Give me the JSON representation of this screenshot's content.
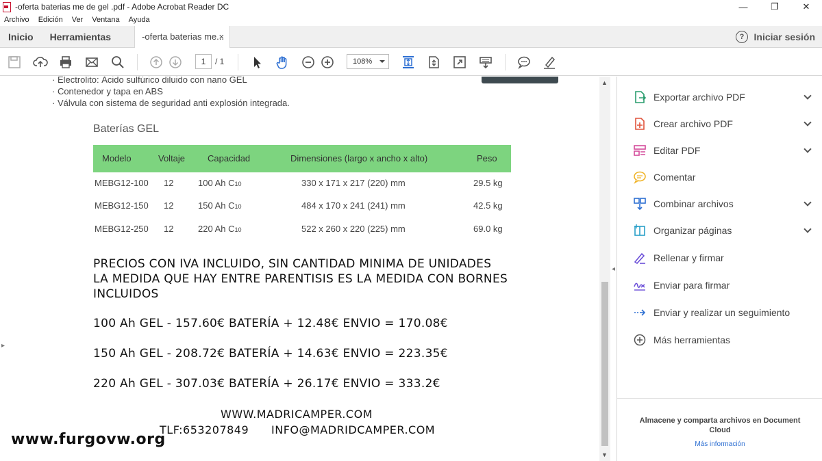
{
  "window": {
    "title": "-oferta baterias me de gel .pdf - Adobe Acrobat Reader DC",
    "minimize": "—",
    "maximize": "❐",
    "close": "✕"
  },
  "menu": [
    "Archivo",
    "Edición",
    "Ver",
    "Ventana",
    "Ayuda"
  ],
  "tabs": {
    "home": "Inicio",
    "tools": "Herramientas",
    "document": "-oferta baterias me...",
    "close": "×",
    "help": "?",
    "signin": "Iniciar sesión"
  },
  "toolbar": {
    "page_current": "1",
    "page_total": "/ 1",
    "zoom": "108%"
  },
  "document": {
    "bullets": [
      "· Electrolito: Ácido sulfúrico diluido con nano GEL",
      "· Contenedor y tapa en ABS",
      "· Válvula con sistema de seguridad anti explosión integrada."
    ],
    "table_title": "Baterías GEL",
    "table_headers": [
      "Modelo",
      "Voltaje",
      "Capacidad",
      "Dimensiones (largo x ancho x alto)",
      "Peso"
    ],
    "rows": [
      {
        "model": "MEBG12-100",
        "voltage": "12",
        "capacity": "100 Ah C",
        "sub": "10",
        "dims": "330 x 171 x 217 (220) mm",
        "weight": "29.5 kg"
      },
      {
        "model": "MEBG12-150",
        "voltage": "12",
        "capacity": "150 Ah C",
        "sub": "10",
        "dims": "484 x 170 x 241 (241) mm",
        "weight": "42.5 kg"
      },
      {
        "model": "MEBG12-250",
        "voltage": "12",
        "capacity": "220 Ah C",
        "sub": "10",
        "dims": "522 x 260 x 220 (225) mm",
        "weight": "69.0 kg"
      }
    ],
    "notice_lines": [
      "PRECIOS CON IVA INCLUIDO, SIN CANTIDAD MINIMA DE UNIDADES",
      "LA MEDIDA QUE HAY ENTRE PARENTISIS ES LA MEDIDA CON BORNES",
      "INCLUIDOS"
    ],
    "prices": [
      "100 Ah GEL - 157.60€ BATERÍA + 12.48€ ENVIO = 170.08€",
      "150 Ah GEL - 208.72€ BATERÍA + 14.63€ ENVIO = 223.35€",
      "220 Ah GEL - 307.03€ BATERÍA + 26.17€ ENVIO = 333.2€"
    ],
    "website": "WWW.MADRICAMPER.COM",
    "phone": "TLF:653207849",
    "email": "INFO@MADRIDCAMPER.COM",
    "watermark": "www.furgovw.org"
  },
  "tools_panel": [
    {
      "label": "Exportar archivo PDF",
      "icon": "export-pdf-icon",
      "color": "#2a9d6e"
    },
    {
      "label": "Crear archivo PDF",
      "icon": "create-pdf-icon",
      "color": "#e0533b"
    },
    {
      "label": "Editar PDF",
      "icon": "edit-pdf-icon",
      "color": "#d44a9a"
    },
    {
      "label": "Comentar",
      "icon": "comment-icon",
      "color": "#f0b429"
    },
    {
      "label": "Combinar archivos",
      "icon": "combine-files-icon",
      "color": "#2d6fd2"
    },
    {
      "label": "Organizar páginas",
      "icon": "organize-pages-icon",
      "color": "#2aa0c8"
    },
    {
      "label": "Rellenar y firmar",
      "icon": "fill-sign-icon",
      "color": "#6b4fd8"
    },
    {
      "label": "Enviar para firmar",
      "icon": "send-sign-icon",
      "color": "#6b4fd8"
    },
    {
      "label": "Enviar y realizar un seguimiento",
      "icon": "send-track-icon",
      "color": "#2d6fd2"
    },
    {
      "label": "Más herramientas",
      "icon": "more-tools-icon",
      "color": "#555555"
    }
  ],
  "cloud": {
    "text": "Almacene y comparta archivos en Document Cloud",
    "link": "Más información"
  }
}
